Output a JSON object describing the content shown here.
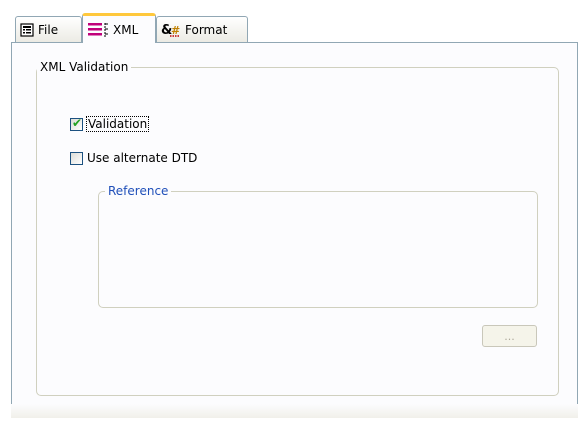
{
  "tabs": [
    {
      "label": "File",
      "icon": "document-icon"
    },
    {
      "label": "XML",
      "icon": "xml-lines-icon"
    },
    {
      "label": "Format",
      "icon": "format-icon"
    }
  ],
  "active_tab": "XML",
  "xml_group": {
    "title": "XML Validation",
    "validation": {
      "label": "Validation",
      "checked": true
    },
    "alternate_dtd": {
      "label": "Use alternate DTD",
      "checked": false
    },
    "reference": {
      "title": "Reference"
    },
    "browse_button": {
      "label": "...",
      "enabled": false
    }
  },
  "colors": {
    "active_tab_accent": "#ffc83c",
    "checkmark": "#21a121",
    "reference_legend": "#1f4fb9",
    "border": "#91a7b4"
  }
}
